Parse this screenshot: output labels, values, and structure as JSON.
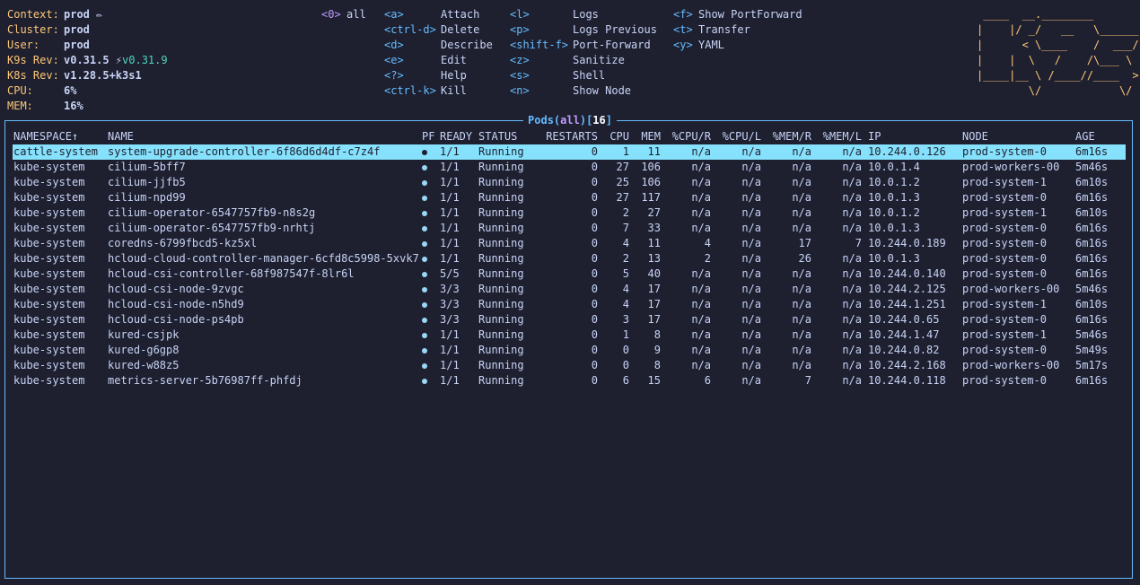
{
  "info": [
    {
      "label": "Context:",
      "value": "prod",
      "extra": "✏"
    },
    {
      "label": "Cluster:",
      "value": "prod"
    },
    {
      "label": "User:",
      "value": "prod"
    },
    {
      "label": "K9s Rev:",
      "value": "v0.31.5",
      "extra": "⚡",
      "new_version": "v0.31.9"
    },
    {
      "label": "K8s Rev:",
      "value": "v1.28.5+k3s1"
    },
    {
      "label": "CPU:",
      "value": "6%"
    },
    {
      "label": "MEM:",
      "value": "16%"
    }
  ],
  "namespaces": [
    {
      "key": "<0>",
      "label": "all"
    }
  ],
  "shortcuts_col1": [
    {
      "key": "<a>",
      "desc": "Attach"
    },
    {
      "key": "<ctrl-d>",
      "desc": "Delete"
    },
    {
      "key": "<d>",
      "desc": "Describe"
    },
    {
      "key": "<e>",
      "desc": "Edit"
    },
    {
      "key": "<?>",
      "desc": "Help"
    },
    {
      "key": "<ctrl-k>",
      "desc": "Kill"
    }
  ],
  "shortcuts_col2": [
    {
      "key": "<l>",
      "desc": "Logs"
    },
    {
      "key": "<p>",
      "desc": "Logs Previous"
    },
    {
      "key": "<shift-f>",
      "desc": "Port-Forward"
    },
    {
      "key": "<z>",
      "desc": "Sanitize"
    },
    {
      "key": "<s>",
      "desc": "Shell"
    },
    {
      "key": "<n>",
      "desc": "Show Node"
    }
  ],
  "shortcuts_col3": [
    {
      "key": "<f>",
      "desc": "Show PortForward"
    },
    {
      "key": "<t>",
      "desc": "Transfer"
    },
    {
      "key": "<y>",
      "desc": "YAML"
    }
  ],
  "logo_lines": [
    " ____  __.________       ",
    "|    |/ _/   __   \\______",
    "|      < \\____    /  ___/",
    "|    |  \\   /    /\\___ \\ ",
    "|____|__ \\ /____//____  >",
    "        \\/            \\/ "
  ],
  "view": {
    "resource": "Pods",
    "filter": "all",
    "count": "16"
  },
  "columns": [
    "NAMESPACE↑",
    "NAME",
    "PF",
    "READY",
    "STATUS",
    "RESTARTS",
    "CPU",
    "MEM",
    "%CPU/R",
    "%CPU/L",
    "%MEM/R",
    "%MEM/L",
    "IP",
    "NODE",
    "AGE"
  ],
  "pods": [
    [
      "cattle-system",
      "system-upgrade-controller-6f86d6d4df-c7z4f",
      "●",
      "1/1",
      "Running",
      "0",
      "1",
      "11",
      "n/a",
      "n/a",
      "n/a",
      "n/a",
      "10.244.0.126",
      "prod-system-0",
      "6m16s"
    ],
    [
      "kube-system",
      "cilium-5bff7",
      "●",
      "1/1",
      "Running",
      "0",
      "27",
      "106",
      "n/a",
      "n/a",
      "n/a",
      "n/a",
      "10.0.1.4",
      "prod-workers-00",
      "5m46s"
    ],
    [
      "kube-system",
      "cilium-jjfb5",
      "●",
      "1/1",
      "Running",
      "0",
      "25",
      "106",
      "n/a",
      "n/a",
      "n/a",
      "n/a",
      "10.0.1.2",
      "prod-system-1",
      "6m10s"
    ],
    [
      "kube-system",
      "cilium-npd99",
      "●",
      "1/1",
      "Running",
      "0",
      "27",
      "117",
      "n/a",
      "n/a",
      "n/a",
      "n/a",
      "10.0.1.3",
      "prod-system-0",
      "6m16s"
    ],
    [
      "kube-system",
      "cilium-operator-6547757fb9-n8s2g",
      "●",
      "1/1",
      "Running",
      "0",
      "2",
      "27",
      "n/a",
      "n/a",
      "n/a",
      "n/a",
      "10.0.1.2",
      "prod-system-1",
      "6m10s"
    ],
    [
      "kube-system",
      "cilium-operator-6547757fb9-nrhtj",
      "●",
      "1/1",
      "Running",
      "0",
      "7",
      "33",
      "n/a",
      "n/a",
      "n/a",
      "n/a",
      "10.0.1.3",
      "prod-system-0",
      "6m16s"
    ],
    [
      "kube-system",
      "coredns-6799fbcd5-kz5xl",
      "●",
      "1/1",
      "Running",
      "0",
      "4",
      "11",
      "4",
      "n/a",
      "17",
      "7",
      "10.244.0.189",
      "prod-system-0",
      "6m16s"
    ],
    [
      "kube-system",
      "hcloud-cloud-controller-manager-6cfd8c5998-5xvk7",
      "●",
      "1/1",
      "Running",
      "0",
      "2",
      "13",
      "2",
      "n/a",
      "26",
      "n/a",
      "10.0.1.3",
      "prod-system-0",
      "6m16s"
    ],
    [
      "kube-system",
      "hcloud-csi-controller-68f987547f-8lr6l",
      "●",
      "5/5",
      "Running",
      "0",
      "5",
      "40",
      "n/a",
      "n/a",
      "n/a",
      "n/a",
      "10.244.0.140",
      "prod-system-0",
      "6m16s"
    ],
    [
      "kube-system",
      "hcloud-csi-node-9zvgc",
      "●",
      "3/3",
      "Running",
      "0",
      "4",
      "17",
      "n/a",
      "n/a",
      "n/a",
      "n/a",
      "10.244.2.125",
      "prod-workers-00",
      "5m46s"
    ],
    [
      "kube-system",
      "hcloud-csi-node-n5hd9",
      "●",
      "3/3",
      "Running",
      "0",
      "4",
      "17",
      "n/a",
      "n/a",
      "n/a",
      "n/a",
      "10.244.1.251",
      "prod-system-1",
      "6m10s"
    ],
    [
      "kube-system",
      "hcloud-csi-node-ps4pb",
      "●",
      "3/3",
      "Running",
      "0",
      "3",
      "17",
      "n/a",
      "n/a",
      "n/a",
      "n/a",
      "10.244.0.65",
      "prod-system-0",
      "6m16s"
    ],
    [
      "kube-system",
      "kured-csjpk",
      "●",
      "1/1",
      "Running",
      "0",
      "1",
      "8",
      "n/a",
      "n/a",
      "n/a",
      "n/a",
      "10.244.1.47",
      "prod-system-1",
      "5m46s"
    ],
    [
      "kube-system",
      "kured-g6gp8",
      "●",
      "1/1",
      "Running",
      "0",
      "0",
      "9",
      "n/a",
      "n/a",
      "n/a",
      "n/a",
      "10.244.0.82",
      "prod-system-0",
      "5m49s"
    ],
    [
      "kube-system",
      "kured-w88z5",
      "●",
      "1/1",
      "Running",
      "0",
      "0",
      "8",
      "n/a",
      "n/a",
      "n/a",
      "n/a",
      "10.244.2.168",
      "prod-workers-00",
      "5m17s"
    ],
    [
      "kube-system",
      "metrics-server-5b76987ff-phfdj",
      "●",
      "1/1",
      "Running",
      "0",
      "6",
      "15",
      "6",
      "n/a",
      "7",
      "n/a",
      "10.244.0.118",
      "prod-system-0",
      "6m16s"
    ]
  ],
  "selected_row": 0,
  "colors": {
    "background": "#1e2030",
    "label": "#ffc777",
    "key": "#65bcff",
    "namespace_key": "#c099ff",
    "selection": "#86e1fc",
    "new_version": "#4fd6be"
  }
}
